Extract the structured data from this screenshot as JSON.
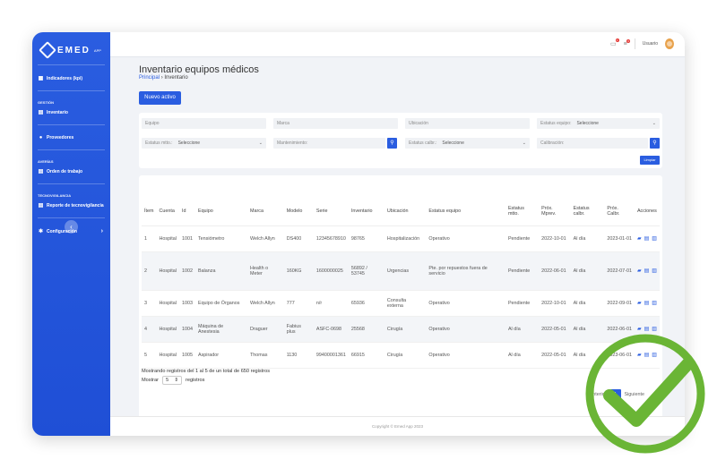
{
  "brand": {
    "name": "EMED",
    "sup": "APP"
  },
  "sidebar": {
    "items": [
      {
        "label": "Indicadores (kpi)",
        "icon": "chart-icon"
      },
      {
        "section": "GESTIÓN"
      },
      {
        "label": "Inventario",
        "icon": "document-icon"
      },
      {
        "label": "Proveedores",
        "icon": "users-icon"
      },
      {
        "section": "AVERÍAS"
      },
      {
        "label": "Orden de trabajo",
        "icon": "document-icon"
      },
      {
        "section": "TECNOVIGILANCIA"
      },
      {
        "label": "Reporte de tecnovigilancia",
        "icon": "document-icon"
      },
      {
        "label": "Configuración",
        "icon": "gear-icon"
      }
    ],
    "collapse_glyph": "‹"
  },
  "topbar": {
    "user": "Usuario",
    "notif_count": "1",
    "msg_count": "3"
  },
  "page": {
    "title": "Inventario equipos médicos",
    "breadcrumb_root": "Principal",
    "breadcrumb_sep": "›",
    "breadcrumb_current": "Inventario",
    "new_button": "Nuevo activo"
  },
  "filters": {
    "equipo": "Equipo",
    "marca": "Marca",
    "ubicacion": "Ubicación",
    "estatus_equipo": "Estatus equipo:",
    "estatus_mtto": "Estatus mtto.:",
    "mantenimiento": "Mantenimiento:",
    "estatus_calbr": "Estatus calbr.:",
    "calibracion": "Calibración:",
    "select_default": "Seleccione",
    "clear_button": "Limpiar"
  },
  "table": {
    "headers": [
      "Ítem",
      "Cuenta",
      "Id",
      "Equipo",
      "Marca",
      "Modelo",
      "Serie",
      "Inventario",
      "Ubicación",
      "Estatus equipo",
      "Estatus mtto.",
      "Próx. Mprev.",
      "Estatus calbr.",
      "Próx. Calbr.",
      "Acciones"
    ],
    "rows": [
      [
        "1",
        "Hospital",
        "1001",
        "Tensiómetro",
        "Welch Allyn",
        "DS400",
        "12345678910",
        "98765",
        "Hospitalización",
        "Operativo",
        "Pendiente",
        "2022-10-01",
        "Al día",
        "2023-01-01"
      ],
      [
        "2",
        "Hospital",
        "1002",
        "Balanza",
        "Health o Meter",
        "160KG",
        "1600000025",
        "56892 / 53745",
        "Urgencias",
        "Pte. por repuestos fuera de servicio",
        "Pendiente",
        "2022-06-01",
        "Al día",
        "2022-07-01"
      ],
      [
        "3",
        "Hospital",
        "1003",
        "Equipo de Órganos",
        "Welch Allyn",
        "777",
        "n/r",
        "65936",
        "Consulta externa",
        "Operativo",
        "Pendiente",
        "2022-10-01",
        "Al día",
        "2022-09-01"
      ],
      [
        "4",
        "Hospital",
        "1004",
        "Máquina de Anestesia",
        "Draguer",
        "Fabius plus",
        "ASFC-0698",
        "25568",
        "Cirugía",
        "Operativo",
        "Al día",
        "2022-05-01",
        "Al día",
        "2022-06-01"
      ],
      [
        "5",
        "Hospital",
        "1005",
        "Aspirador",
        "Thomas",
        "1130",
        "99400001361",
        "66915",
        "Cirugía",
        "Operativo",
        "Al día",
        "2022-05-01",
        "Al día",
        "2023-06-01"
      ]
    ]
  },
  "pagination": {
    "info": "Mostrando registros del 1 al 5 de un total de 650 registros",
    "show_label": "Mostrar",
    "show_value": "5",
    "records_label": "registros",
    "prev": "Anterior",
    "current": "1",
    "next": "Siguiente"
  },
  "footer": {
    "text": "Copyright © Emed App 2023"
  },
  "colors": {
    "primary": "#2a5de0",
    "check": "#6ab535"
  }
}
